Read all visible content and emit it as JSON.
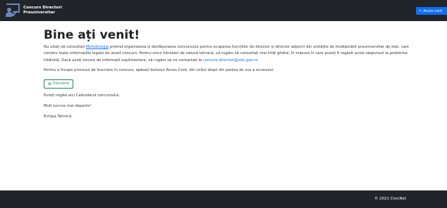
{
  "navbar": {
    "brand_line1": "Concurs Directori",
    "brand_line2": "Preuniversitar",
    "logo_icon": "teacher-at-board-icon",
    "login_icon": "sign-in-icon",
    "login_label": "Acces cont"
  },
  "main": {
    "title": "Bine ați venit!",
    "intro_before": "Nu uitați să consultați ",
    "intro_link": "Metodologia",
    "intro_after": " privind organizarea și desfășurarea concursului pentru ocuparea funcțiilor de director și director adjunct din unitățile de învățământ preuniversitar de stat, care conține toate informațiile legate de acest concurs. Pentru orice întrebări de natură tehnică, vă rugăm să consultați mai întâi ghidul, în măsura în care puteți fi regăsit acolo răspunsul la problema întâlnită. Dacă aveți nevoie de informații suplimentare, vă rugăm să ne contactați la ",
    "intro_email": "concurs.directori@edu.gov.ro",
    "intro_end": ".",
    "start_text": "Pentru a începe procesul de înscriere în concurs, apăsați butonul Acces Cont, din colțul drept din partea de sus a ecranului.",
    "signup_icon": "add-user-icon",
    "signup_label": "Înscriere",
    "calendar_text": "Puteți regăsi aici Calendarul concursului.",
    "success_text": "Mult succes mai departe!",
    "team_text": "Echipa Tehnică"
  },
  "footer": {
    "copyright": "© 2021 CivicNet"
  },
  "colors": {
    "navbar_bg": "#212529",
    "primary": "#0d6efd",
    "success": "#198754"
  }
}
